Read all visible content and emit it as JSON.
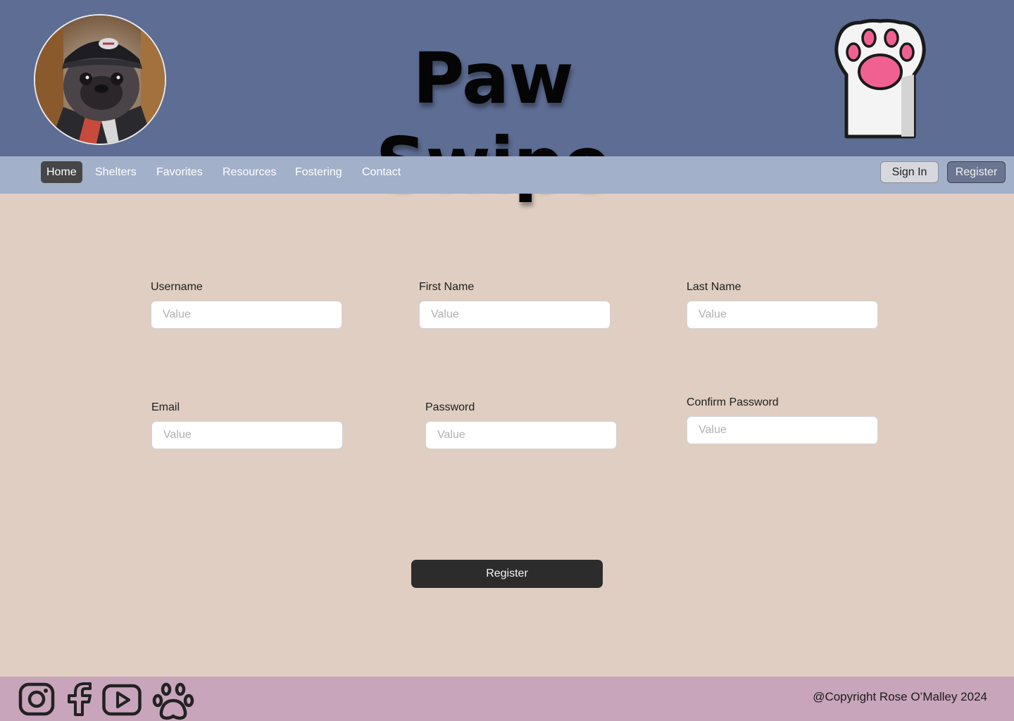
{
  "header": {
    "title": "Paw Swipe",
    "avatar_icon": "pug-avatar-icon",
    "logo_icon": "paw-logo-icon"
  },
  "nav": {
    "items": [
      {
        "label": "Home",
        "active": true
      },
      {
        "label": "Shelters",
        "active": false
      },
      {
        "label": "Favorites",
        "active": false
      },
      {
        "label": "Resources",
        "active": false
      },
      {
        "label": "Fostering",
        "active": false
      },
      {
        "label": "Contact",
        "active": false
      }
    ],
    "sign_in": "Sign In",
    "register": "Register"
  },
  "form": {
    "username": {
      "label": "Username",
      "placeholder": "Value"
    },
    "first_name": {
      "label": "First Name",
      "placeholder": "Value"
    },
    "last_name": {
      "label": "Last Name",
      "placeholder": "Value"
    },
    "email": {
      "label": "Email",
      "placeholder": "Value"
    },
    "password": {
      "label": "Password",
      "placeholder": "Value"
    },
    "confirm_password": {
      "label": "Confirm Password",
      "placeholder": "Value"
    },
    "submit": "Register"
  },
  "footer": {
    "social_icons": [
      "instagram-icon",
      "facebook-icon",
      "youtube-icon",
      "paw-icon"
    ],
    "copyright": "@Copyright Rose O’Malley 2024"
  },
  "colors": {
    "header_bg": "#5d6d93",
    "nav_bg": "#a2b0c9",
    "page_bg": "#dfcec1",
    "footer_bg": "#c8a5ba",
    "button_dark": "#2c2c2c"
  }
}
